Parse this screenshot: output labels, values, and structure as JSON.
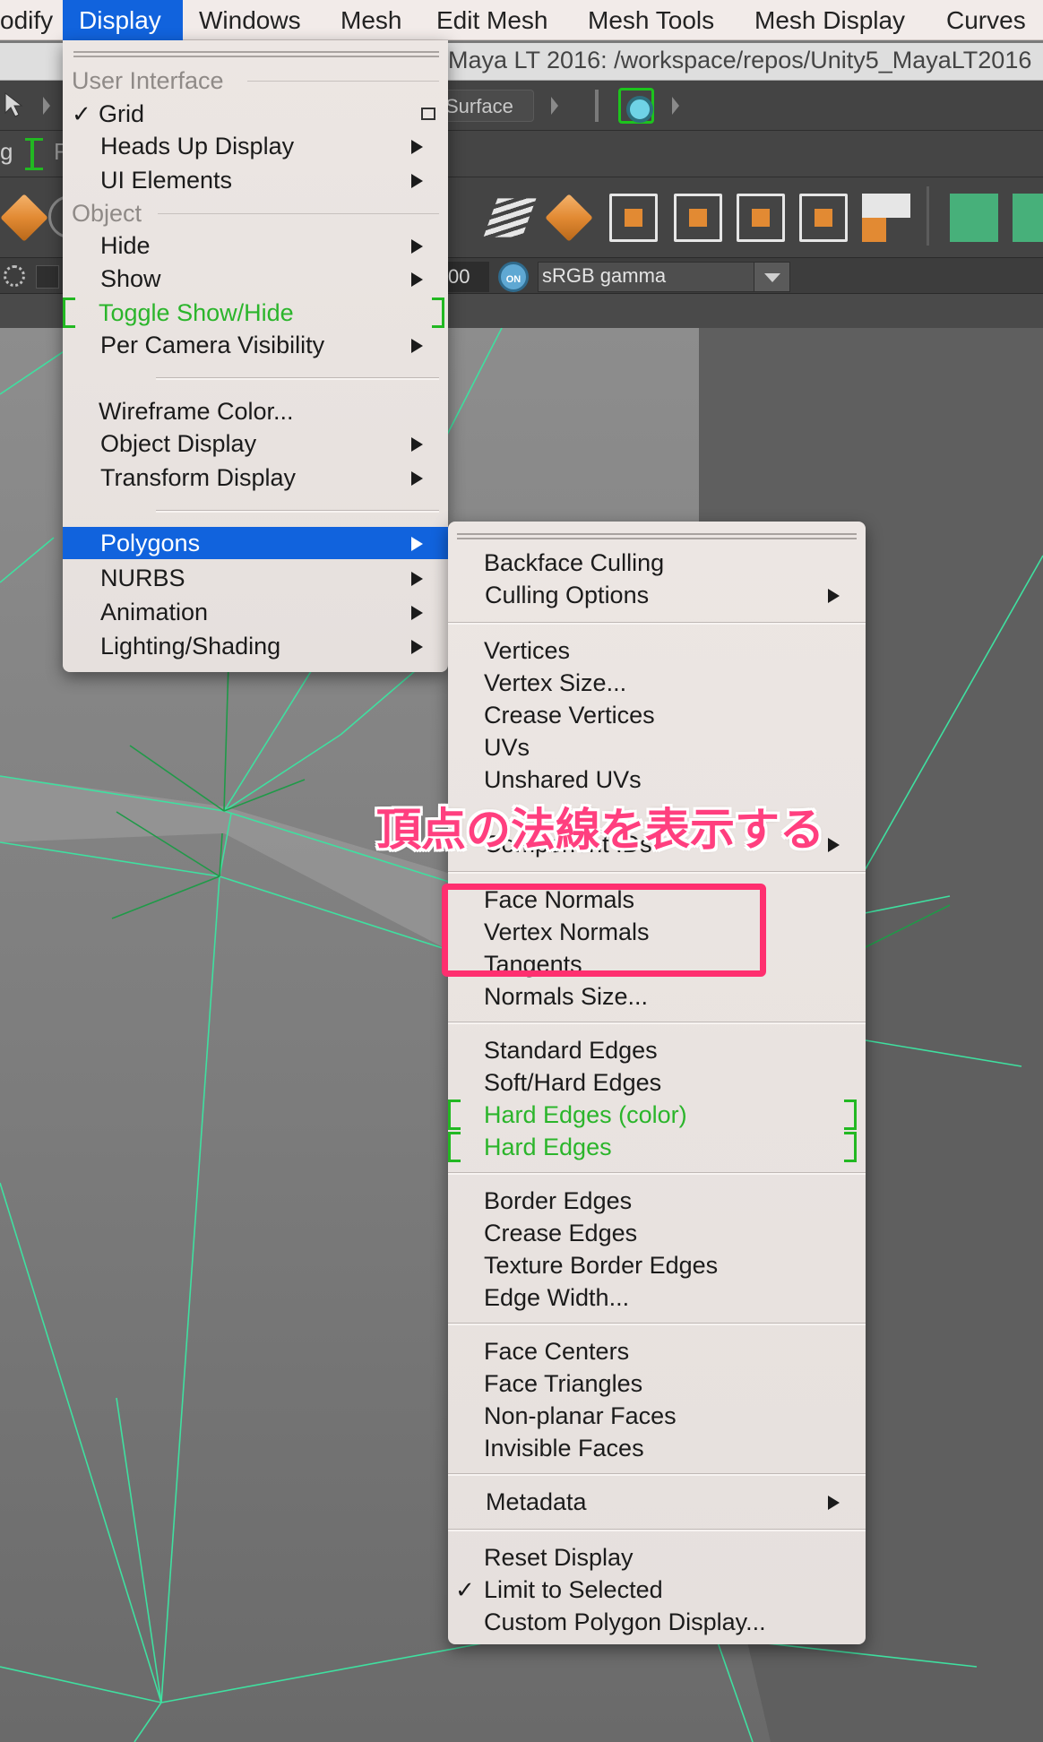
{
  "menubar": {
    "items": [
      "odify",
      "Display",
      "Windows",
      "Mesh",
      "Edit Mesh",
      "Mesh Tools",
      "Mesh Display",
      "Curves"
    ]
  },
  "window": {
    "title": "Maya LT 2016: /workspace/repos/Unity5_MayaLT2016"
  },
  "toolbar": {
    "surface_label": "Surface",
    "row2_left_text": "g",
    "row2_right_text": "R",
    "field_value": "00",
    "on_badge": "ON",
    "colorspace_value": "sRGB gamma"
  },
  "display_menu": {
    "section_user_interface": "User Interface",
    "section_object": "Object",
    "items": [
      {
        "label": "Grid",
        "checked": true,
        "option_box": true
      },
      {
        "label": "Heads Up Display",
        "submenu": true
      },
      {
        "label": "UI Elements",
        "submenu": true
      },
      {
        "label": "Hide",
        "submenu": true
      },
      {
        "label": "Show",
        "submenu": true
      },
      {
        "label": "Toggle Show/Hide",
        "highlighted_green": true
      },
      {
        "label": "Per Camera Visibility",
        "submenu": true
      },
      {
        "label": "Wireframe Color..."
      },
      {
        "label": "Object Display",
        "submenu": true
      },
      {
        "label": "Transform Display",
        "submenu": true
      },
      {
        "label": "Polygons",
        "submenu": true,
        "selected": true
      },
      {
        "label": "NURBS",
        "submenu": true
      },
      {
        "label": "Animation",
        "submenu": true
      },
      {
        "label": "Lighting/Shading",
        "submenu": true
      }
    ]
  },
  "polygons_menu": {
    "items": [
      {
        "label": "Backface Culling"
      },
      {
        "label": "Culling Options",
        "submenu": true
      },
      {
        "label": "Vertices"
      },
      {
        "label": "Vertex Size..."
      },
      {
        "label": "Crease Vertices"
      },
      {
        "label": "UVs"
      },
      {
        "label": "Unshared UVs"
      },
      {
        "label": "Component IDs",
        "submenu": true
      },
      {
        "label": "Face Normals"
      },
      {
        "label": "Vertex Normals"
      },
      {
        "label": "Tangents"
      },
      {
        "label": "Normals Size..."
      },
      {
        "label": "Standard Edges"
      },
      {
        "label": "Soft/Hard Edges"
      },
      {
        "label": "Hard Edges (color)",
        "highlighted_green": true
      },
      {
        "label": "Hard Edges",
        "highlighted_green": true
      },
      {
        "label": "Border Edges"
      },
      {
        "label": "Crease Edges"
      },
      {
        "label": "Texture Border Edges"
      },
      {
        "label": "Edge Width..."
      },
      {
        "label": "Face Centers"
      },
      {
        "label": "Face Triangles"
      },
      {
        "label": "Non-planar Faces"
      },
      {
        "label": "Invisible Faces"
      },
      {
        "label": "Metadata",
        "submenu": true
      },
      {
        "label": "Reset Display"
      },
      {
        "label": "Limit to Selected",
        "checked": true
      },
      {
        "label": "Custom Polygon Display..."
      }
    ]
  },
  "annotation": {
    "text": "頂点の法線を表示する"
  },
  "glyphs": {
    "check": "✓"
  },
  "colors": {
    "accent_blue": "#1163dd",
    "highlight_green": "#2bb52b",
    "annotation_pink": "#ff3f7f",
    "wire_green": "#3fe0a0"
  }
}
